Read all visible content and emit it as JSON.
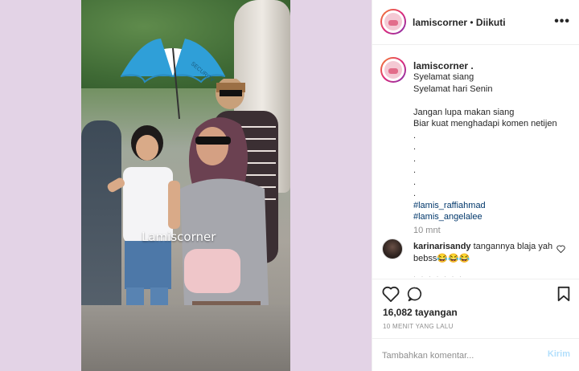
{
  "video": {
    "watermark": "Lamiscorner",
    "umbrella_text": "SECURITY"
  },
  "header": {
    "username": "lamiscorner",
    "separator": " • ",
    "follow_status": "Diikuti",
    "more_icon": "more-horizontal-icon"
  },
  "caption": {
    "username": "lamiscorner .",
    "lines": [
      "Syelamat siang",
      "Syelamat hari Senin",
      "",
      "Jangan lupa makan siang",
      "Biar kuat menghadapi komen netijen",
      ".",
      ".",
      ".",
      ".",
      ".",
      "."
    ],
    "hashtags": [
      "#lamis_raffiahmad",
      "#lamis_angelalee"
    ],
    "time": "10 mnt"
  },
  "comment": {
    "username": "karinarisandy",
    "text": "tangannya blaja yah bebss😂😂😂"
  },
  "actions": {
    "like_icon": "heart-icon",
    "comment_icon": "comment-bubble-icon",
    "save_icon": "bookmark-icon"
  },
  "stats": {
    "views": "16,082 tayangan",
    "ago": "10 MENIT YANG LALU"
  },
  "comment_box": {
    "placeholder": "Tambahkan komentar...",
    "post_label": "Kirim"
  },
  "colors": {
    "background": "#e3d3e6",
    "umbrella_blue": "#2f9fd8",
    "link": "#00376b",
    "post_disabled": "#b2dffc"
  }
}
